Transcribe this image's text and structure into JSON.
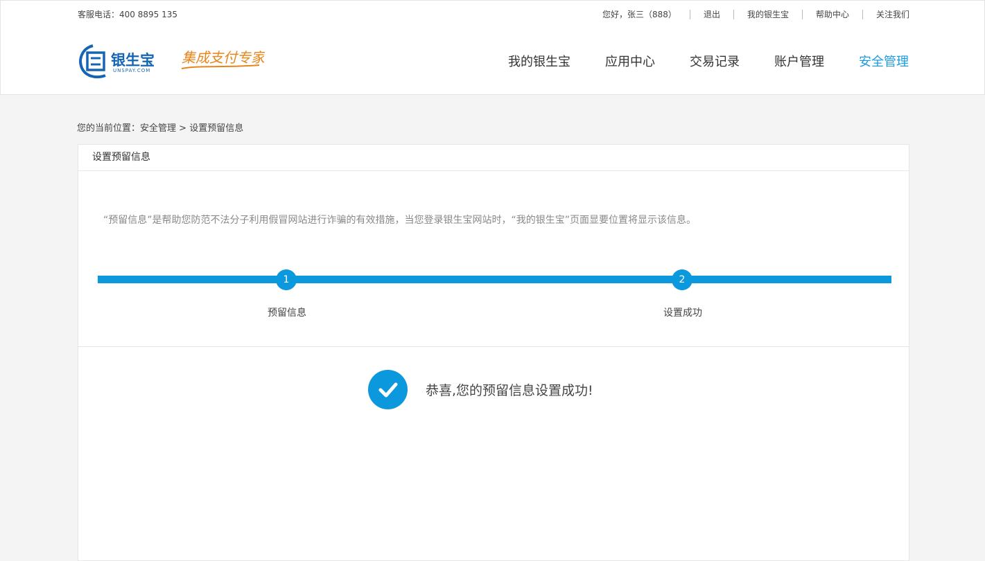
{
  "topbar": {
    "hotline": "客服电话：400 8895 135",
    "greeting": "您好，张三（888）",
    "links": [
      "退出",
      "我的银生宝",
      "帮助中心",
      "关注我们"
    ]
  },
  "logo": {
    "brand_cn": "银生宝",
    "brand_en": "UNSPAY.COM",
    "slogan": "集成支付专家"
  },
  "nav": {
    "items": [
      "我的银生宝",
      "应用中心",
      "交易记录",
      "账户管理",
      "安全管理"
    ],
    "active_index": 4
  },
  "breadcrumb": {
    "prefix": "您的当前位置：",
    "section": "安全管理",
    "separator": ">",
    "current": "设置预留信息"
  },
  "panel": {
    "title": "设置预留信息",
    "description": "“预留信息”是帮助您防范不法分子利用假冒网站进行诈骗的有效措施，当您登录银生宝网站时，“我的银生宝”页面显要位置将显示该信息。"
  },
  "steps": [
    {
      "number": "1",
      "label": "预留信息"
    },
    {
      "number": "2",
      "label": "设置成功"
    }
  ],
  "result": {
    "message": "恭喜,您的预留信息设置成功!"
  },
  "colors": {
    "accent": "#0b98dc",
    "nav_active": "#1b9be0",
    "slogan": "#e8851a",
    "page_bg": "#f4f4f4"
  }
}
